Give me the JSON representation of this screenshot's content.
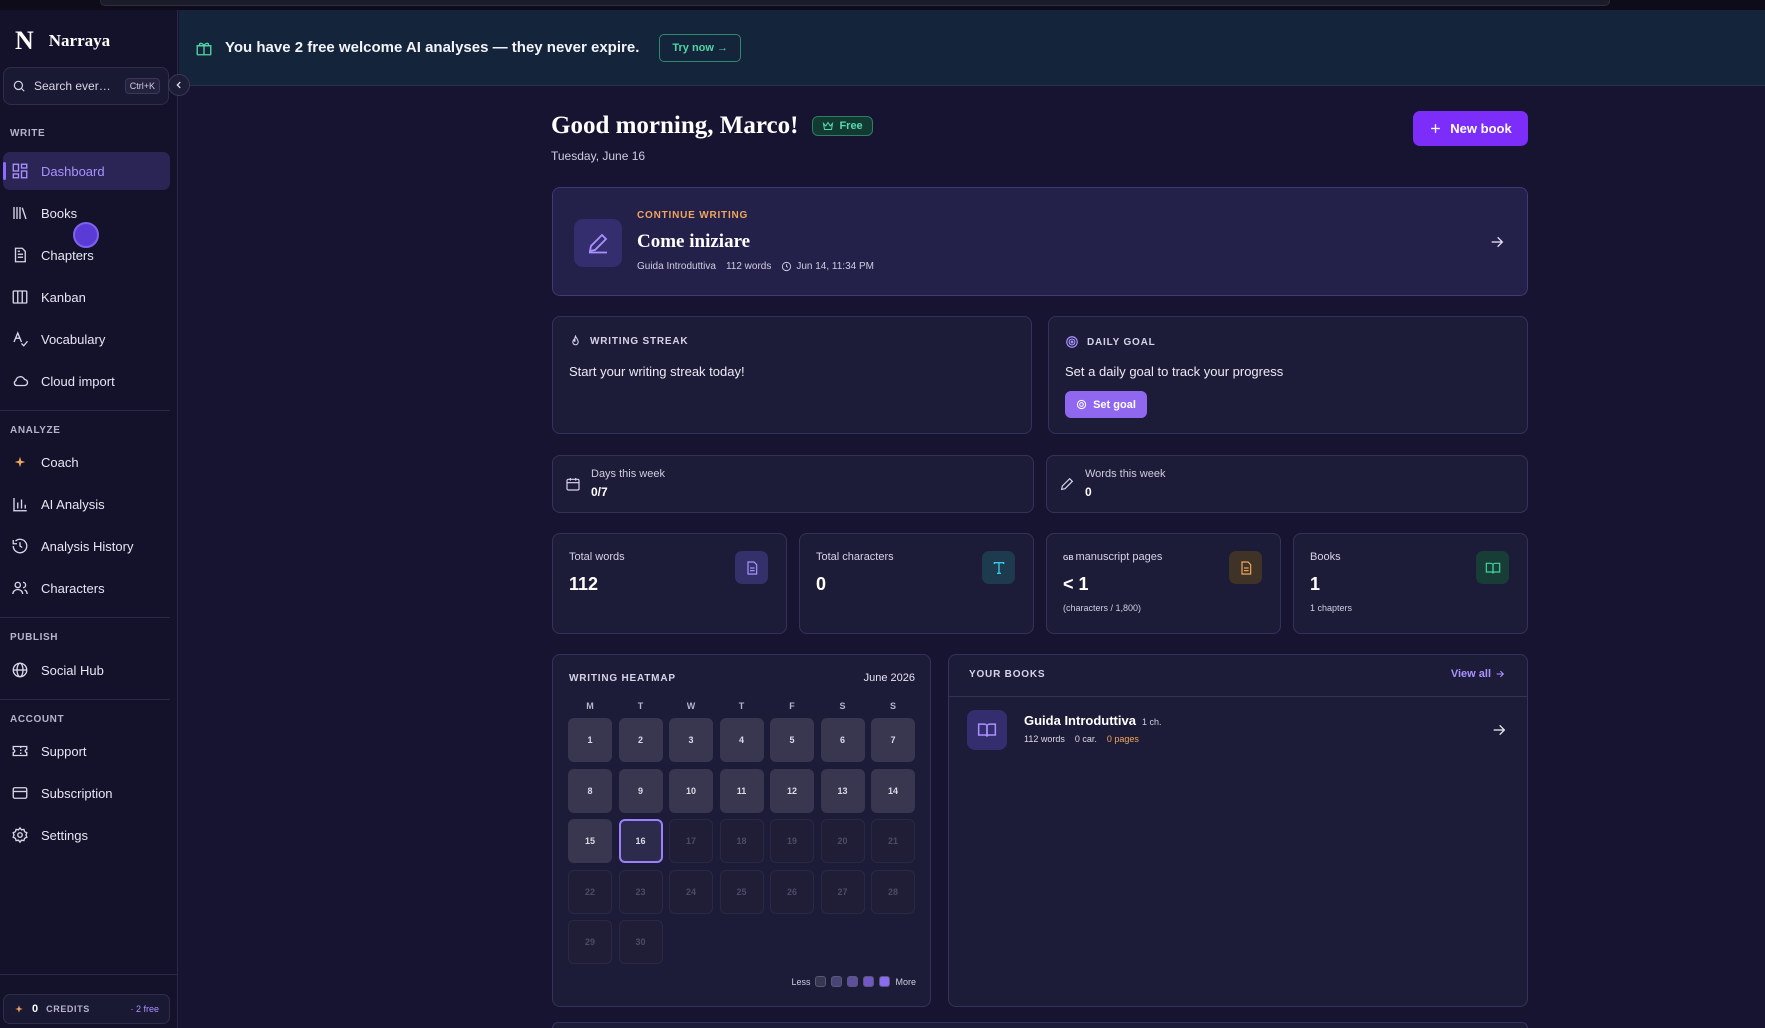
{
  "app": {
    "logo": "N",
    "name": "Narraya"
  },
  "search": {
    "placeholder": "Search ever…",
    "shortcut": "Ctrl+K"
  },
  "sidebar": {
    "sections": {
      "write": "WRITE",
      "analyze": "ANALYZE",
      "publish": "PUBLISH",
      "account": "ACCOUNT"
    },
    "write": [
      "Dashboard",
      "Books",
      "Chapters",
      "Kanban",
      "Vocabulary",
      "Cloud import"
    ],
    "analyze": [
      "Coach",
      "AI Analysis",
      "Analysis History",
      "Characters"
    ],
    "publish": [
      "Social Hub"
    ],
    "account": [
      "Support",
      "Subscription",
      "Settings"
    ]
  },
  "credits": {
    "count": "0",
    "label": "CREDITS",
    "free": "· 2 free"
  },
  "banner": {
    "message": "You have 2 free welcome AI analyses — they never expire.",
    "cta": "Try now →"
  },
  "header": {
    "greeting": "Good morning, Marco!",
    "plan": "Free",
    "date": "Tuesday, June 16",
    "new_book": "New book"
  },
  "continue": {
    "kicker": "CONTINUE WRITING",
    "title": "Come iniziare",
    "book": "Guida Introduttiva",
    "words": "112 words",
    "time": "Jun 14, 11:34 PM"
  },
  "streak": {
    "title": "WRITING STREAK",
    "text": "Start your writing streak today!"
  },
  "goal": {
    "title": "DAILY GOAL",
    "text": "Set a daily goal to track your progress",
    "button": "Set goal"
  },
  "week": {
    "days": {
      "label": "Days this week",
      "value": "0/7"
    },
    "words": {
      "label": "Words this week",
      "value": "0"
    }
  },
  "stats": {
    "words": {
      "label": "Total words",
      "value": "112"
    },
    "chars": {
      "label": "Total characters",
      "value": "0"
    },
    "pages": {
      "prefix": "GB",
      "label": "manuscript pages",
      "value": "< 1",
      "sub": "(characters / 1,800)"
    },
    "books": {
      "label": "Books",
      "value": "1",
      "sub": "1 chapters"
    }
  },
  "heatmap": {
    "title": "WRITING HEATMAP",
    "month": "June 2026",
    "weekdays": [
      "M",
      "T",
      "W",
      "T",
      "F",
      "S",
      "S"
    ],
    "days": [
      "1",
      "2",
      "3",
      "4",
      "5",
      "6",
      "7",
      "8",
      "9",
      "10",
      "11",
      "12",
      "13",
      "14",
      "15",
      "16",
      "17",
      "18",
      "19",
      "20",
      "21",
      "22",
      "23",
      "24",
      "25",
      "26",
      "27",
      "28",
      "29",
      "30"
    ],
    "today": 16,
    "legend_less": "Less",
    "legend_more": "More",
    "legend_colors": [
      "#39374f",
      "#4a4376",
      "#5e4f9e",
      "#7258c4",
      "#8a6cf0"
    ]
  },
  "books": {
    "title": "YOUR BOOKS",
    "view_all": "View all",
    "items": [
      {
        "title": "Guida Introduttiva",
        "chapters": "1 ch.",
        "words": "112 words",
        "chars": "0 car.",
        "pages": "0 pages"
      }
    ]
  },
  "colors": {
    "accent": "#7c2dfa",
    "accent_soft": "#a992ff",
    "warn": "#f0a55c",
    "success": "#4fd6a6"
  }
}
